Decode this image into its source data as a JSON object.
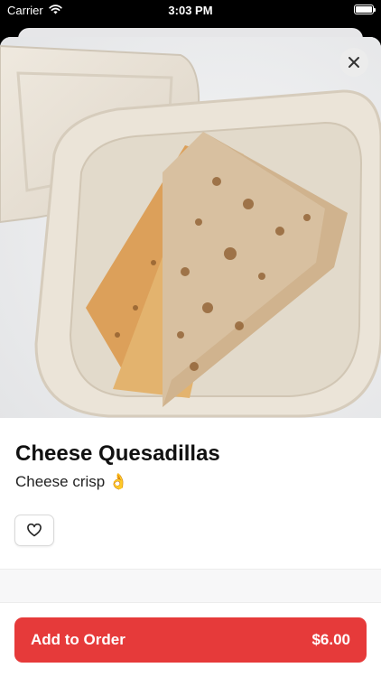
{
  "status_bar": {
    "carrier": "Carrier",
    "time": "3:03 PM"
  },
  "item": {
    "name": "Cheese Quesadillas",
    "description": "Cheese crisp 👌",
    "image": "quesadilla-photo"
  },
  "actions": {
    "add_to_order_label": "Add to Order",
    "price": "$6.00"
  },
  "icons": {
    "close": "close-icon",
    "favorite": "heart-icon",
    "wifi": "wifi-icon",
    "battery": "battery-icon"
  },
  "colors": {
    "accent": "#e63a3a"
  }
}
